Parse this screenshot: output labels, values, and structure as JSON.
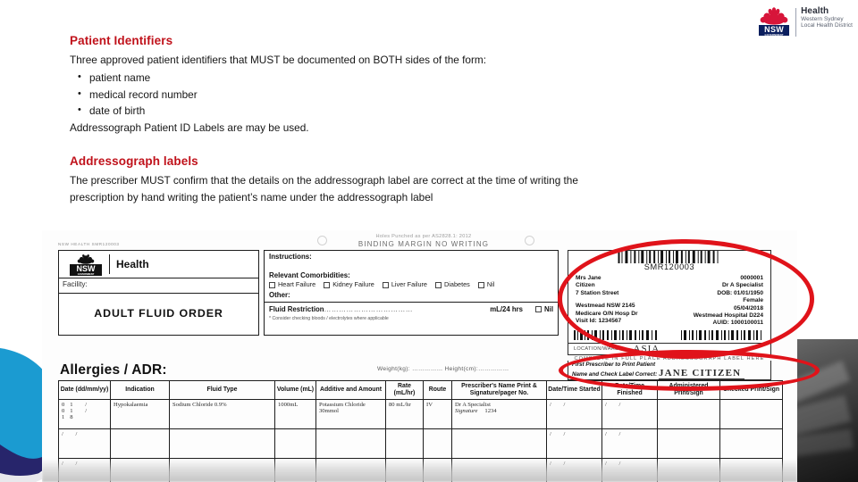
{
  "brand": {
    "logo_line1": "Health",
    "logo_line2": "Western Sydney",
    "logo_line3": "Local Health District",
    "nsw_word": "NSW",
    "nsw_sub": "GOVERNMENT",
    "accent_red": "#C0121B",
    "navy": "#0a1e5e"
  },
  "content": {
    "heading1": "Patient Identifiers",
    "intro": "Three approved patient identifiers that MUST be documented on BOTH sides of the form:",
    "bullets": [
      "patient name",
      "medical record number",
      "date of birth"
    ],
    "closing": "Addressograph Patient ID Labels are may be used.",
    "heading2": "Addressograph labels",
    "paragraph2": "The prescriber MUST confirm that the details on the addressograph label are correct at the time of writing the prescription by hand writing the patient’s name under the addressograph label"
  },
  "form": {
    "binding_note_small": "Holes Punched as per AS2828.1: 2012",
    "binding_note": "BINDING MARGIN    NO WRITING",
    "tiny_corner_note": "NSW HEALTH   SMR120003",
    "header": {
      "nsw_word": "NSW",
      "nsw_sub": "GOVERNMENT",
      "health": "Health",
      "facility_label": "Facility:",
      "title": "ADULT FLUID ORDER"
    },
    "instructions": {
      "instructions_label": "Instructions:",
      "comorbidities_label": "Relevant Comorbidities:",
      "comorbidity_options": [
        "Heart Failure",
        "Kidney Failure",
        "Liver Failure",
        "Diabetes",
        "Nil"
      ],
      "other_label": "Other:",
      "fluid_restriction_label": "Fluid Restriction",
      "fluid_restriction_dots": "………………………………",
      "fluid_restriction_unit": "mL/24 hrs",
      "nil_label": "Nil",
      "footnote": "* Consider checking bloods / electrolytes where applicable"
    },
    "label": {
      "barcode_text": "SMR120003",
      "left_lines": [
        "Mrs Jane",
        "Citizen",
        "7 Station Street",
        "",
        "Westmead NSW 2145",
        "Medicare O/N Hosp Dr",
        "Visit Id: 1234567"
      ],
      "right_lines": [
        "0000001",
        "Dr A Specialist",
        "DOB: 01/01/1950",
        "Female",
        "05/04/2018",
        "Westmead Hospital D224",
        "AUID: 1000100011"
      ],
      "location_label": "LOCATION/WARD",
      "location_value": "ASIA",
      "complete_bar": "COMPLETE IN FULL   PLACE ADDRESSOGRAPH LABEL HERE"
    },
    "prescriber_block": {
      "line1": "First Prescriber to Print Patient",
      "line2": "Name and Check Label Correct:",
      "handwritten_name": "JANE CITIZEN"
    },
    "allergies_label": "Allergies / ADR:",
    "weight_height": "Weight(kg): …………… Height(cm):……………",
    "table": {
      "headers": [
        "Date\n(dd/mm/yy)",
        "Indication",
        "Fluid Type",
        "Volume\n(mL)",
        "Additive and\nAmount",
        "Rate\n(mL/hr)",
        "Route",
        "Prescriber's Name Print\n& Signature/pager No.",
        "Date/Time\nStarted",
        "Date/Time\nFinished",
        "Administered\nPrint/Sign",
        "Checked\nPrint/Sign"
      ],
      "rows": [
        {
          "date": "01 / 01 / 18",
          "indication": "Hypokalaemia",
          "fluid_type": "Sodium Chloride 0.9%",
          "volume": "1000mL",
          "additive": "Potassium Chloride 30mmol",
          "rate": "80 mL/hr",
          "route": "IV",
          "prescriber": "Dr A Specialist",
          "prescriber_sig": "Signature",
          "pager": "1234",
          "started": "/      /",
          "finished": "/      /",
          "administered": "",
          "checked": ""
        },
        {
          "date": "/      /",
          "indication": "",
          "fluid_type": "",
          "volume": "",
          "additive": "",
          "rate": "",
          "route": "",
          "prescriber": "",
          "prescriber_sig": "",
          "pager": "",
          "started": "/      /",
          "finished": "/      /",
          "administered": "",
          "checked": ""
        },
        {
          "date": "/      /",
          "indication": "",
          "fluid_type": "",
          "volume": "",
          "additive": "",
          "rate": "",
          "route": "",
          "prescriber": "",
          "prescriber_sig": "",
          "pager": "",
          "started": "/      /",
          "finished": "/      /",
          "administered": "",
          "checked": ""
        }
      ]
    }
  },
  "annotations": {
    "ellipse_label": "red-ellipse-around-addressograph-label",
    "ellipse_prescriber": "red-ellipse-around-prescriber-print-line",
    "color": "#E0131A"
  }
}
